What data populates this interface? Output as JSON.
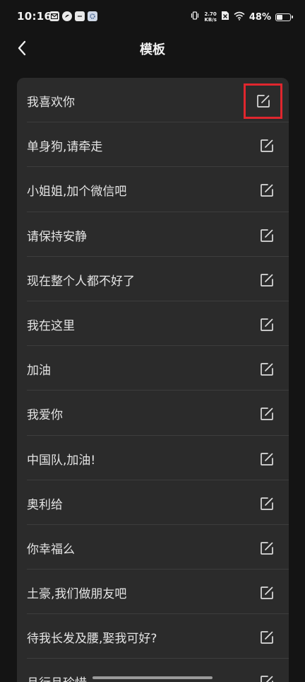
{
  "status_bar": {
    "time": "10:16",
    "net_speed_value": "2.70",
    "net_speed_unit": "KB/s",
    "battery_label": "48%",
    "battery_level": 0.48,
    "icons": [
      "mail-icon",
      "bird-app-icon",
      "chat-bubble-icon",
      "gear-app-icon",
      "vibrate-icon",
      "no-sim-icon",
      "wifi-icon",
      "battery-icon"
    ]
  },
  "header": {
    "title": "模板",
    "back_icon": "chevron-left-icon"
  },
  "templates": [
    {
      "label": "我喜欢你"
    },
    {
      "label": "单身狗,请牵走"
    },
    {
      "label": "小姐姐,加个微信吧"
    },
    {
      "label": "请保持安静"
    },
    {
      "label": "现在整个人都不好了"
    },
    {
      "label": "我在这里"
    },
    {
      "label": "加油"
    },
    {
      "label": "我爱你"
    },
    {
      "label": "中国队,加油!"
    },
    {
      "label": "奥利给"
    },
    {
      "label": "你幸福么"
    },
    {
      "label": "土豪,我们做朋友吧"
    },
    {
      "label": "待我长发及腰,娶我可好?"
    },
    {
      "label": "且行且珍惜"
    }
  ],
  "highlight": {
    "row_index": 0,
    "color": "#e0262e"
  },
  "colors": {
    "background": "#141414",
    "card": "#2b2b2b",
    "divider": "#3d3d3d",
    "text": "#e4e4e4"
  }
}
